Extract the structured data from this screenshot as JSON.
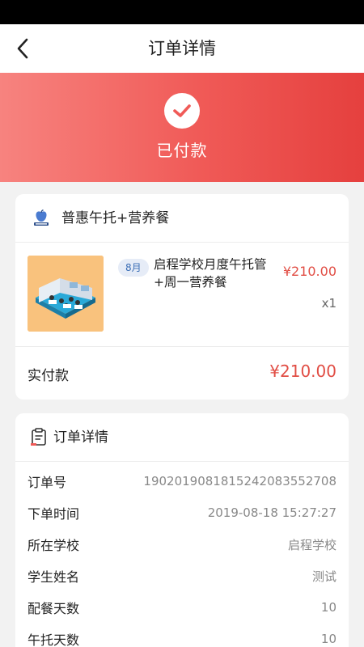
{
  "nav": {
    "title": "订单详情",
    "back_icon": "chevron-left-icon"
  },
  "status": {
    "label": "已付款",
    "icon": "check-circle-icon"
  },
  "product_card": {
    "title": "普惠午托+营养餐",
    "icon": "apple-book-icon",
    "item": {
      "month_badge": "8月",
      "name": "启程学校月度午托管+周一营养餐",
      "price": "¥210.00",
      "qty": "x1"
    },
    "paid_label": "实付款",
    "paid_amount": "¥210.00"
  },
  "detail_card": {
    "title": "订单详情",
    "icon": "clipboard-icon",
    "rows": [
      {
        "key": "订单号",
        "value": "19020190818152420835527​08"
      },
      {
        "key": "下单时间",
        "value": "2019-08-18 15:27:27"
      },
      {
        "key": "所在学校",
        "value": "启程学校"
      },
      {
        "key": "学生姓名",
        "value": "测试"
      },
      {
        "key": "配餐天数",
        "value": "10"
      },
      {
        "key": "午托天数",
        "value": "10"
      }
    ]
  },
  "colors": {
    "accent": "#f05a57",
    "price": "#e14d44"
  }
}
